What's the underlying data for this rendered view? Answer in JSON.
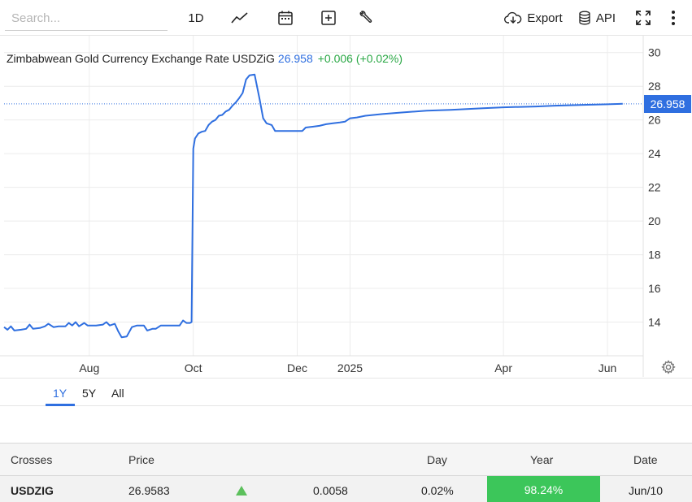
{
  "toolbar": {
    "search_placeholder": "Search...",
    "interval_label": "1D",
    "export_label": "Export",
    "api_label": "API",
    "icons": [
      "line-chart-icon",
      "calendar-icon",
      "add-indicator-icon",
      "wrench-icon",
      "download-cloud-icon",
      "database-icon",
      "fullscreen-icon",
      "more-vertical-icon"
    ]
  },
  "header": {
    "name": "Zimbabwean Gold Currency Exchange Rate USDZiG",
    "price": "26.958",
    "change": "+0.006 (+0.02%)"
  },
  "chart_data": {
    "type": "line",
    "title": "Zimbabwean Gold Currency Exchange Rate USDZiG",
    "xlabel": "",
    "ylabel": "",
    "ylim": [
      12,
      31
    ],
    "xlim": [
      "2024-06-12",
      "2025-06-22"
    ],
    "x_ticks": [
      {
        "date": "2024-08-01",
        "label": "Aug"
      },
      {
        "date": "2024-10-01",
        "label": "Oct"
      },
      {
        "date": "2024-12-01",
        "label": "Dec"
      },
      {
        "date": "2025-01-01",
        "label": "2025"
      },
      {
        "date": "2025-04-01",
        "label": "Apr"
      },
      {
        "date": "2025-06-01",
        "label": "Jun"
      }
    ],
    "y_ticks": [
      14,
      16,
      18,
      20,
      22,
      24,
      26,
      28,
      30
    ],
    "grid": true,
    "last_value": 26.958,
    "last_value_label": "26.958",
    "color": "#2f6fe0",
    "series": [
      {
        "name": "",
        "points": [
          [
            "2024-06-12",
            13.7
          ],
          [
            "2024-06-14",
            13.55
          ],
          [
            "2024-06-16",
            13.75
          ],
          [
            "2024-06-18",
            13.5
          ],
          [
            "2024-06-22",
            13.55
          ],
          [
            "2024-06-25",
            13.6
          ],
          [
            "2024-06-27",
            13.85
          ],
          [
            "2024-06-29",
            13.6
          ],
          [
            "2024-07-03",
            13.65
          ],
          [
            "2024-07-06",
            13.75
          ],
          [
            "2024-07-08",
            13.9
          ],
          [
            "2024-07-11",
            13.7
          ],
          [
            "2024-07-14",
            13.75
          ],
          [
            "2024-07-18",
            13.75
          ],
          [
            "2024-07-20",
            13.95
          ],
          [
            "2024-07-22",
            13.8
          ],
          [
            "2024-07-24",
            14.0
          ],
          [
            "2024-07-26",
            13.75
          ],
          [
            "2024-07-29",
            13.95
          ],
          [
            "2024-07-31",
            13.8
          ],
          [
            "2024-08-05",
            13.8
          ],
          [
            "2024-08-09",
            13.85
          ],
          [
            "2024-08-11",
            14.0
          ],
          [
            "2024-08-13",
            13.8
          ],
          [
            "2024-08-16",
            13.9
          ],
          [
            "2024-08-18",
            13.45
          ],
          [
            "2024-08-20",
            13.1
          ],
          [
            "2024-08-23",
            13.15
          ],
          [
            "2024-08-26",
            13.7
          ],
          [
            "2024-08-29",
            13.8
          ],
          [
            "2024-09-02",
            13.8
          ],
          [
            "2024-09-04",
            13.5
          ],
          [
            "2024-09-07",
            13.6
          ],
          [
            "2024-09-09",
            13.6
          ],
          [
            "2024-09-12",
            13.8
          ],
          [
            "2024-09-18",
            13.8
          ],
          [
            "2024-09-23",
            13.8
          ],
          [
            "2024-09-25",
            14.1
          ],
          [
            "2024-09-27",
            13.95
          ],
          [
            "2024-09-29",
            13.95
          ],
          [
            "2024-09-30",
            14.0
          ],
          [
            "2024-10-01",
            24.3
          ],
          [
            "2024-10-02",
            24.9
          ],
          [
            "2024-10-04",
            25.2
          ],
          [
            "2024-10-06",
            25.3
          ],
          [
            "2024-10-08",
            25.35
          ],
          [
            "2024-10-10",
            25.7
          ],
          [
            "2024-10-12",
            25.9
          ],
          [
            "2024-10-14",
            26.0
          ],
          [
            "2024-10-16",
            26.25
          ],
          [
            "2024-10-18",
            26.3
          ],
          [
            "2024-10-20",
            26.5
          ],
          [
            "2024-10-22",
            26.6
          ],
          [
            "2024-10-24",
            26.85
          ],
          [
            "2024-10-26",
            27.05
          ],
          [
            "2024-10-28",
            27.3
          ],
          [
            "2024-10-30",
            27.6
          ],
          [
            "2024-11-01",
            28.4
          ],
          [
            "2024-11-03",
            28.65
          ],
          [
            "2024-11-06",
            28.7
          ],
          [
            "2024-11-09",
            27.2
          ],
          [
            "2024-11-11",
            26.1
          ],
          [
            "2024-11-13",
            25.8
          ],
          [
            "2024-11-16",
            25.7
          ],
          [
            "2024-11-18",
            25.35
          ],
          [
            "2024-11-22",
            25.35
          ],
          [
            "2024-11-26",
            25.35
          ],
          [
            "2024-11-30",
            25.35
          ],
          [
            "2024-12-04",
            25.35
          ],
          [
            "2024-12-06",
            25.55
          ],
          [
            "2024-12-10",
            25.6
          ],
          [
            "2024-12-14",
            25.65
          ],
          [
            "2024-12-18",
            25.75
          ],
          [
            "2024-12-22",
            25.8
          ],
          [
            "2024-12-26",
            25.85
          ],
          [
            "2024-12-29",
            25.9
          ],
          [
            "2025-01-01",
            26.1
          ],
          [
            "2025-01-05",
            26.15
          ],
          [
            "2025-01-10",
            26.25
          ],
          [
            "2025-01-20",
            26.35
          ],
          [
            "2025-02-01",
            26.45
          ],
          [
            "2025-02-15",
            26.55
          ],
          [
            "2025-03-01",
            26.6
          ],
          [
            "2025-03-20",
            26.7
          ],
          [
            "2025-04-01",
            26.75
          ],
          [
            "2025-04-20",
            26.8
          ],
          [
            "2025-05-01",
            26.85
          ],
          [
            "2025-05-20",
            26.9
          ],
          [
            "2025-06-01",
            26.93
          ],
          [
            "2025-06-10",
            26.958
          ]
        ]
      }
    ]
  },
  "ranges": [
    "1Y",
    "5Y",
    "All"
  ],
  "active_range": "1Y",
  "table": {
    "headers": {
      "crosses": "Crosses",
      "price": "Price",
      "day": "Day",
      "year": "Year",
      "date": "Date"
    },
    "row": {
      "symbol": "USDZIG",
      "price": "26.9583",
      "change": "0.0058",
      "change_pct": "0.02%",
      "year": "98.24%",
      "date": "Jun/10"
    },
    "colors": {
      "up_arrow": "#5cc05c",
      "year_badge": "#3cc65a"
    }
  }
}
